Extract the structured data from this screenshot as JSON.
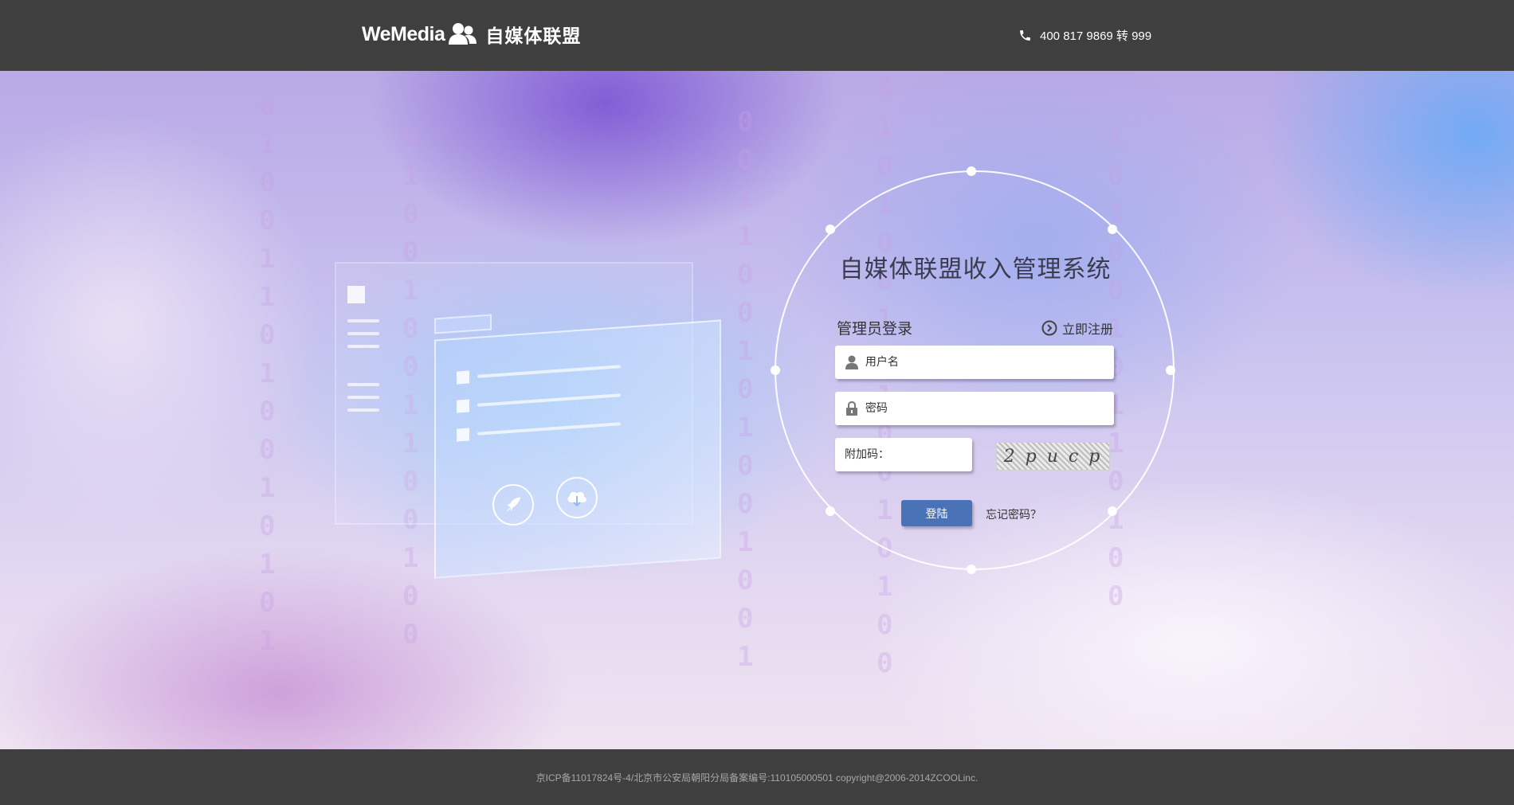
{
  "header": {
    "logo_en": "WeMedia",
    "logo_cn": "自媒体联盟",
    "phone": "400 817 9869 转 999",
    "phone_icon": "phone-icon",
    "logo_icon": "users-icon"
  },
  "login": {
    "title": "自媒体联盟收入管理系统",
    "admin_label": "管理员登录",
    "register_label": "立即注册",
    "username_placeholder": "用户名",
    "password_placeholder": "密码",
    "captcha_placeholder": "附加码：",
    "captcha_text": "2 p u c p",
    "login_button": "登陆",
    "forgot_link": "忘记密码？"
  },
  "footer": {
    "text": "京ICP备11017824号-4/北京市公安局朝阳分局备案编号:110105000501 copyright@2006-2014ZCOOLinc."
  },
  "colors": {
    "header_bg": "#3f3f3f",
    "button_blue": "#4a72b6",
    "text_dark": "#333333"
  }
}
